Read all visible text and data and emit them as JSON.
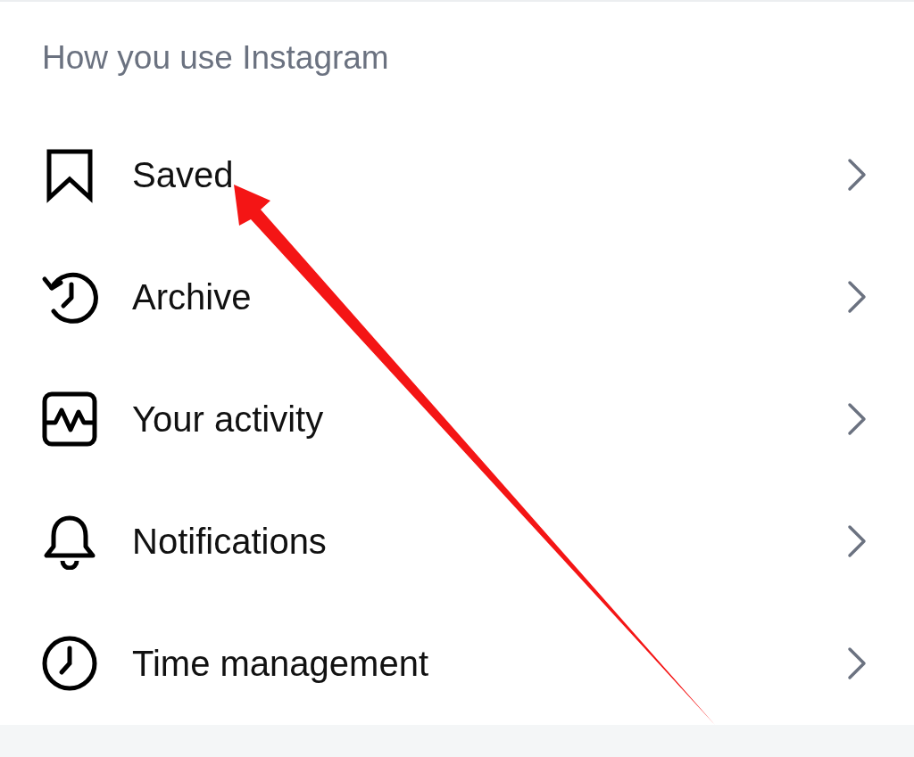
{
  "section_title": "How you use Instagram",
  "items": [
    {
      "kind": "bookmark",
      "label": "Saved"
    },
    {
      "kind": "archive",
      "label": "Archive"
    },
    {
      "kind": "activity",
      "label": "Your activity"
    },
    {
      "kind": "bell",
      "label": "Notifications"
    },
    {
      "kind": "clock",
      "label": "Time management"
    }
  ],
  "annotation": {
    "kind": "arrow"
  }
}
